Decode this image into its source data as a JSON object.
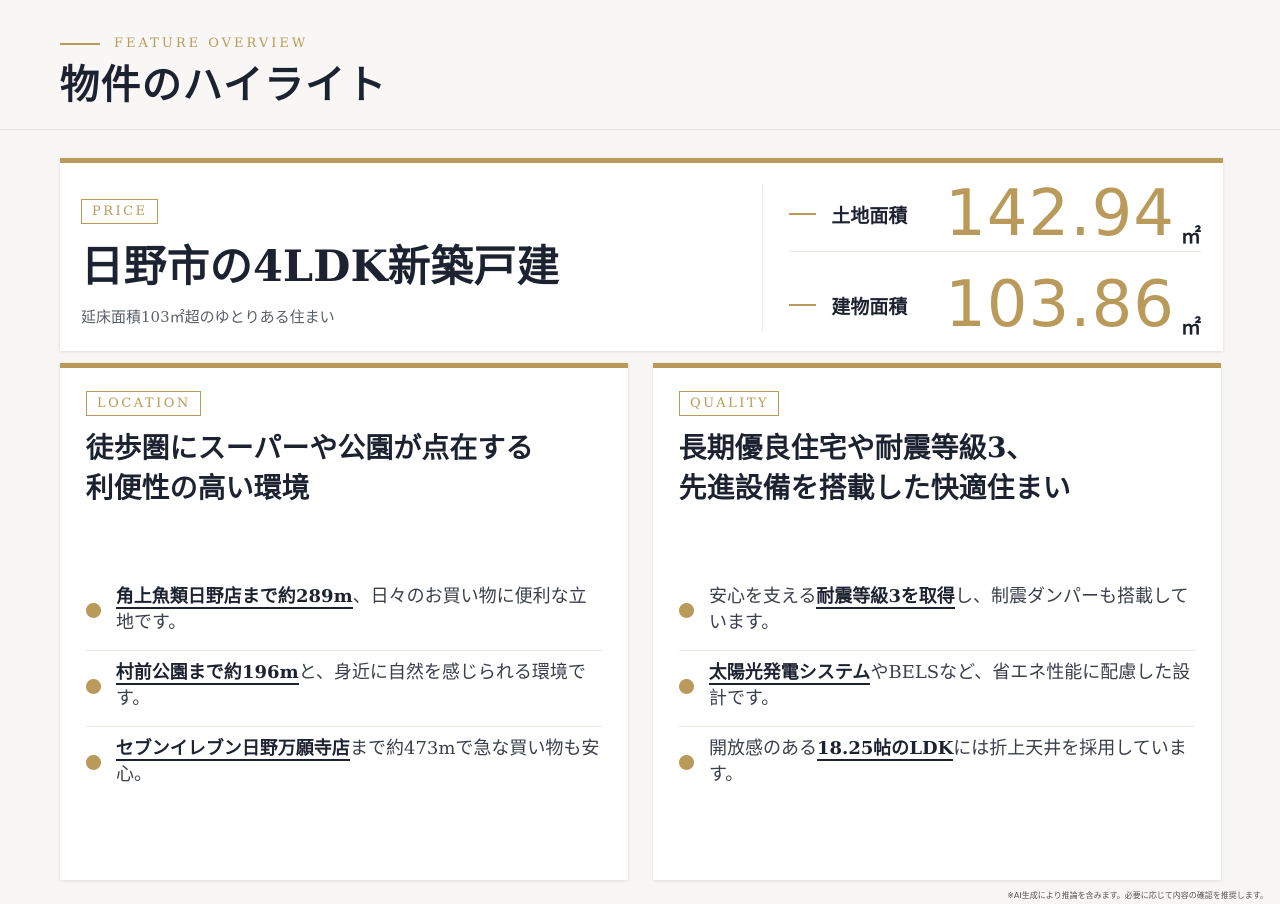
{
  "header": {
    "eyebrow": "FEATURE OVERVIEW",
    "title": "物件のハイライト"
  },
  "price_card": {
    "tag": "PRICE",
    "title": "日野市の4LDK新築戸建",
    "subtitle": "延床面積103㎡超のゆとりある住まい",
    "stats": [
      {
        "label": "土地面積",
        "value": "142.94",
        "unit": "㎡"
      },
      {
        "label": "建物面積",
        "value": "103.86",
        "unit": "㎡"
      }
    ]
  },
  "location": {
    "tag": "LOCATION",
    "heading_line1": "徒歩圏にスーパーや公園が点在する",
    "heading_line2": "利便性の高い環境",
    "items": [
      {
        "highlight": "角上魚類日野店まで約289m",
        "text": "、日々のお買い物に便利な立地です。"
      },
      {
        "highlight": "村前公園まで約196m",
        "text": "と、身近に自然を感じられる環境です。"
      },
      {
        "highlight": "セブンイレブン日野万願寺店",
        "text": "まで約473mで急な買い物も安心。"
      }
    ]
  },
  "quality": {
    "tag": "QUALITY",
    "heading_line1": "長期優良住宅や耐震等級3、",
    "heading_line2": "先進設備を搭載した快適住まい",
    "items": [
      {
        "pre": "安心を支える",
        "highlight": "耐震等級3を取得",
        "text": "し、制震ダンパーも搭載しています。"
      },
      {
        "pre": "",
        "highlight": "太陽光発電システム",
        "text": "やBELSなど、省エネ性能に配慮した設計です。"
      },
      {
        "pre": "開放感のある",
        "highlight": "18.25帖のLDK",
        "text": "には折上天井を採用しています。"
      }
    ]
  },
  "footnote": "※AI生成により推論を含みます。必要に応じて内容の確認を推奨します。",
  "colors": {
    "accent": "#b99a5a",
    "text": "#1c2230"
  }
}
